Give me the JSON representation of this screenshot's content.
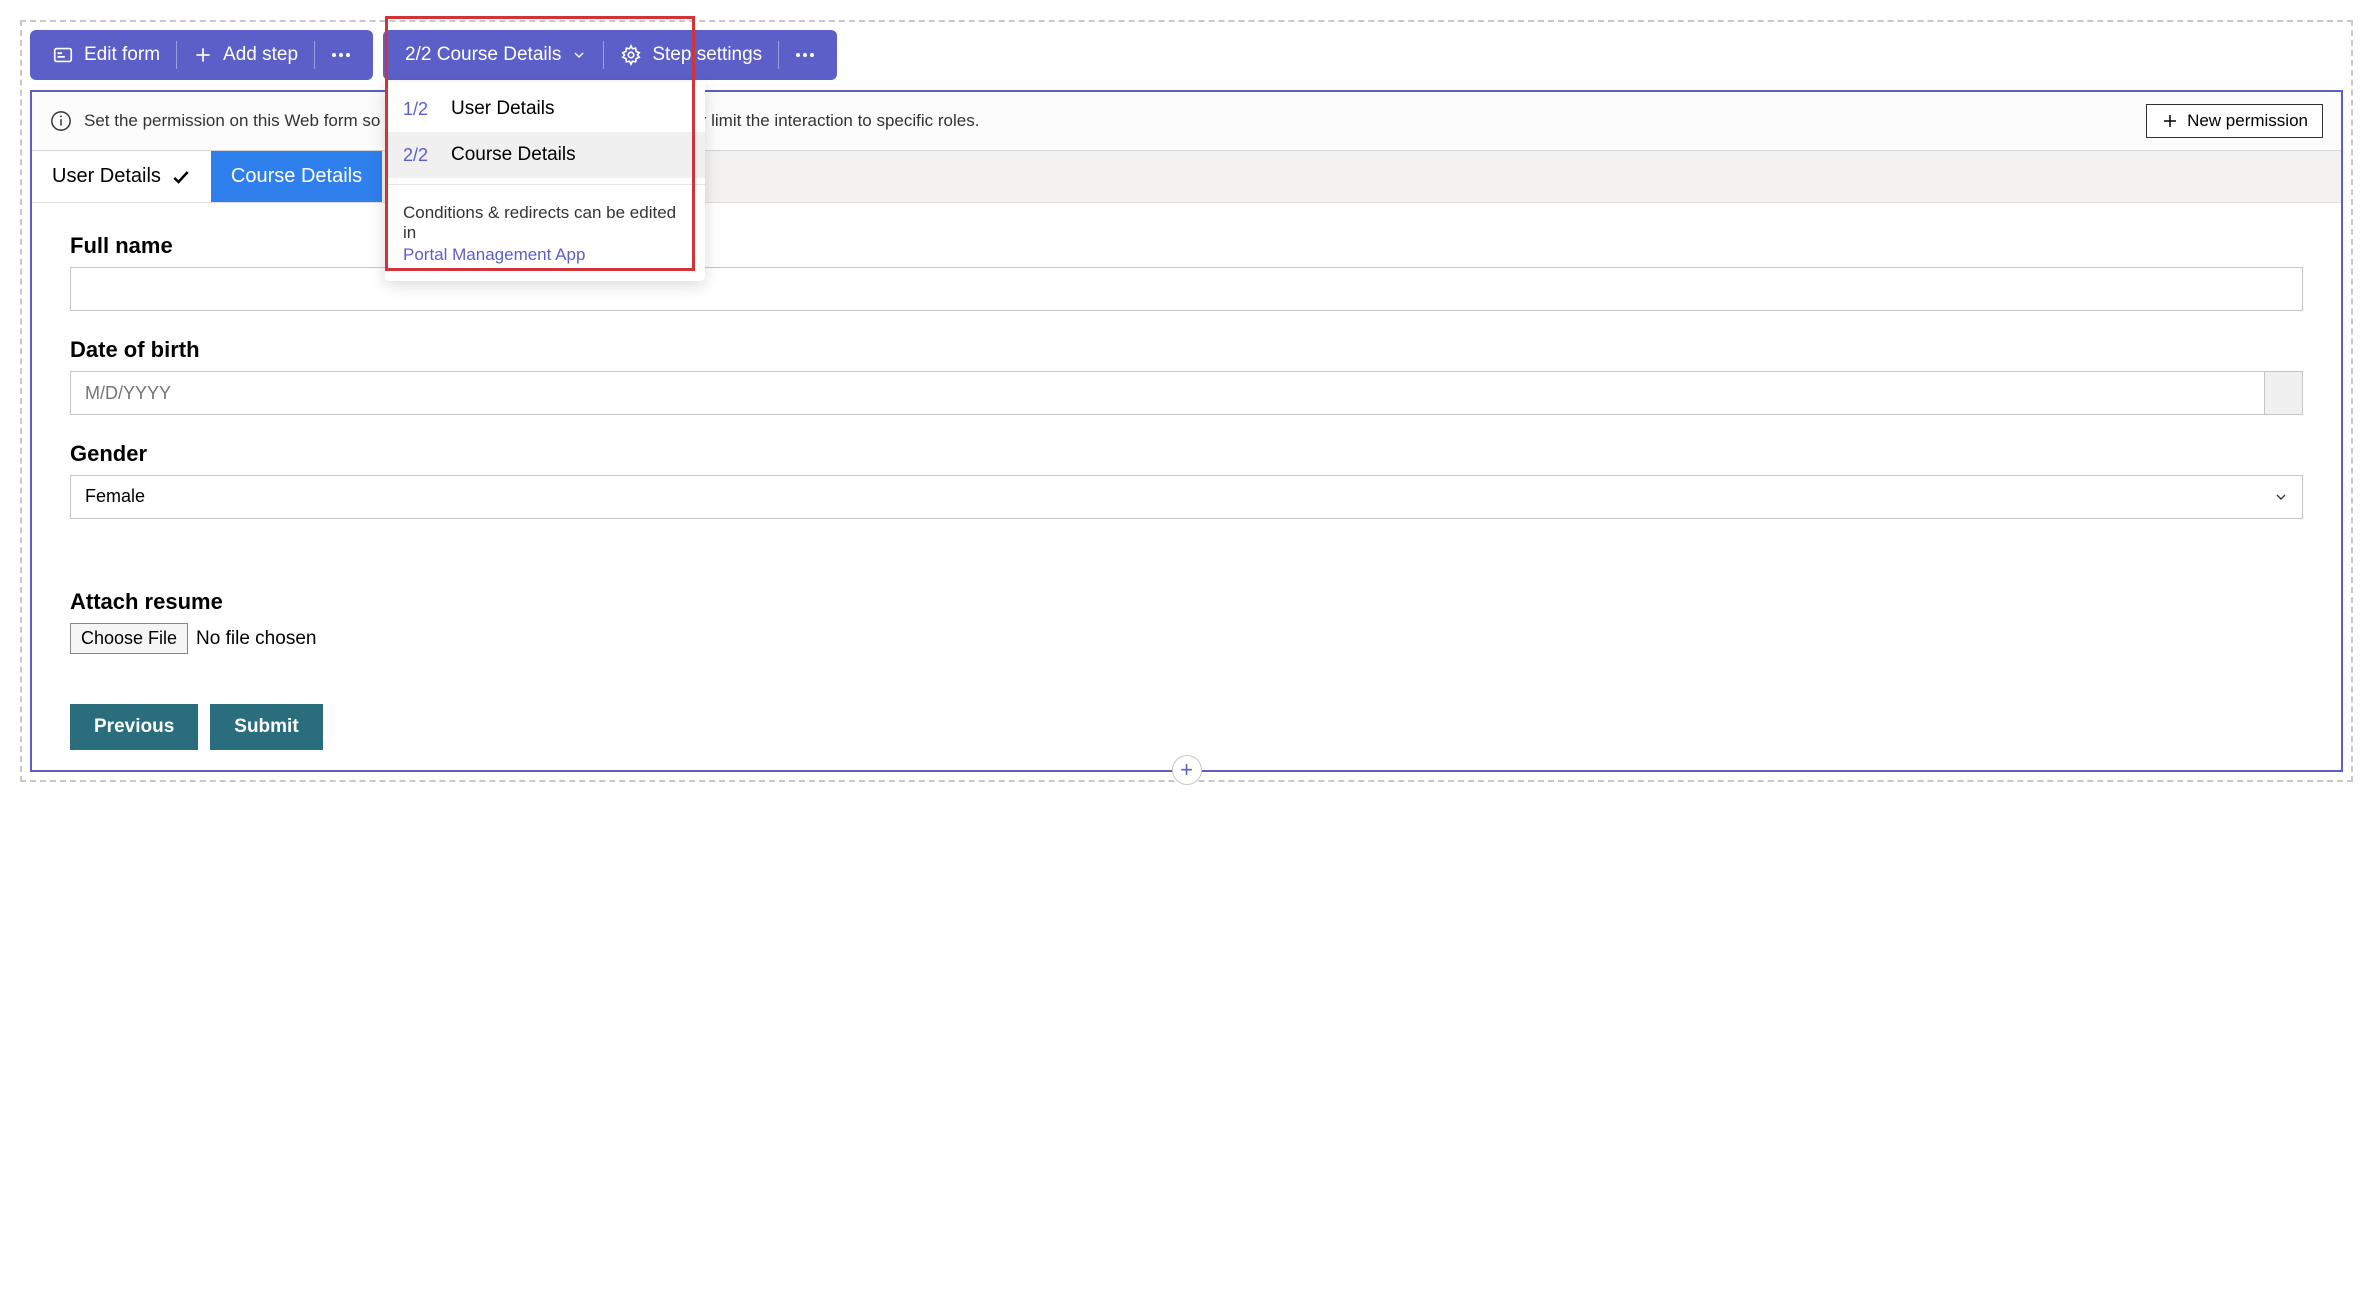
{
  "toolbar": {
    "edit_form_label": "Edit form",
    "add_step_label": "Add step",
    "current_step_label": "2/2 Course Details",
    "step_settings_label": "Step settings"
  },
  "step_dropdown": {
    "items": [
      {
        "fraction": "1/2",
        "label": "User Details"
      },
      {
        "fraction": "2/2",
        "label": "Course Details"
      }
    ],
    "footer_text": "Conditions & redirects can be edited in",
    "footer_link": "Portal Management App"
  },
  "permission_bar": {
    "message": "Set the permission on this Web form so it can appear on the portal for everyone, or limit the interaction to specific roles.",
    "new_permission_label": "New permission"
  },
  "tabs": [
    {
      "label": "User Details",
      "completed": true
    },
    {
      "label": "Course Details",
      "active": true
    }
  ],
  "form": {
    "full_name": {
      "label": "Full name",
      "value": ""
    },
    "dob": {
      "label": "Date of birth",
      "placeholder": "M/D/YYYY"
    },
    "gender": {
      "label": "Gender",
      "selected": "Female"
    },
    "attach": {
      "label": "Attach resume",
      "button": "Choose File",
      "status": "No file chosen"
    },
    "previous_label": "Previous",
    "submit_label": "Submit"
  }
}
